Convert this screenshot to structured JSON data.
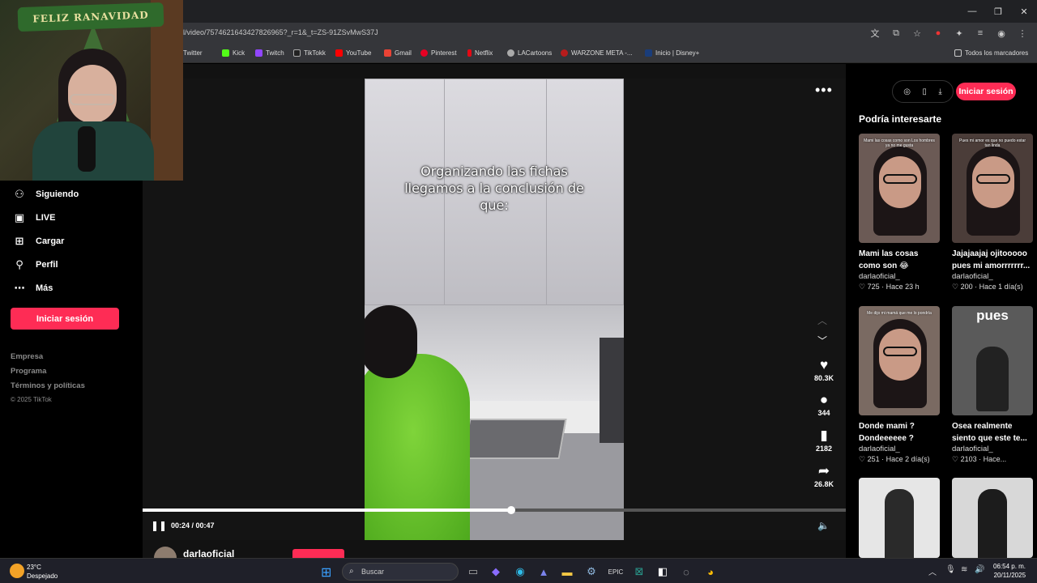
{
  "browser": {
    "url": "l/video/7574621643427826965?_r=1&_t=ZS-91ZSvMwS37J",
    "bookmarks": [
      "Twitter",
      "Kick",
      "Twitch",
      "TikTokk",
      "YouTube",
      "Gmail",
      "Pinterest",
      "Netflix",
      "LACartoons",
      "WARZONE META -...",
      "Inicio | Disney+"
    ],
    "all_bookmarks": "Todos los marcadores"
  },
  "sidebar": {
    "items": [
      {
        "label": "Siguiendo",
        "icon": "following-icon"
      },
      {
        "label": "LIVE",
        "icon": "live-icon"
      },
      {
        "label": "Cargar",
        "icon": "upload-icon"
      },
      {
        "label": "Perfil",
        "icon": "profile-icon"
      },
      {
        "label": "Más",
        "icon": "more-icon"
      }
    ],
    "login_label": "Iniciar sesión",
    "footer_links": [
      "Empresa",
      "Programa",
      "Términos y políticas"
    ],
    "copyright": "© 2025 TikTok"
  },
  "webcam": {
    "banner": "FELIZ RANAVIDAD"
  },
  "video": {
    "caption": "Organizando las fichas llegamos a la conclusión de que:",
    "time_current": "00:24",
    "time_total": "00:47",
    "progress": 0.524,
    "likes": "80.3K",
    "comments": "344",
    "saves": "2182",
    "shares": "26.8K",
    "author": "darlaoficial"
  },
  "right_panel": {
    "login_label": "Iniciar sesión",
    "section_title": "Podría interesarte",
    "cards": [
      {
        "title": "Mami las cosas como son 😂",
        "author": "darlaoficial_",
        "likes": "725",
        "ago": "Hace 23 h",
        "thumb_text": "Mami las cosas como son Los hombres ya no me gusta",
        "accent": "#6b5a55"
      },
      {
        "title": "Jajajaajaj ojitooooo pues mi amorrrrrrr...",
        "author": "darlaoficial_",
        "likes": "200",
        "ago": "Hace 1 día(s)",
        "thumb_text": "Pues mi amor es que no puedo estar tan linda",
        "accent": "#4b3d39"
      },
      {
        "title": "Donde mami ? Dondeeeeee ?",
        "author": "darlaoficial_",
        "likes": "251",
        "ago": "Hace 2 día(s)",
        "thumb_text": "Me dijo mi mamá que me lo pondría",
        "accent": "#7a6a62"
      },
      {
        "title": "Osea realmente siento que este te...",
        "author": "darlaoficial_",
        "likes": "2103",
        "ago": "Hace...",
        "thumb_text": "pues",
        "accent": "#5a5a5a"
      }
    ]
  },
  "taskbar": {
    "temp": "23°C",
    "weather": "Despejado",
    "search_placeholder": "Buscar",
    "time": "06:54 p. m.",
    "date": "20/11/2025"
  },
  "colors": {
    "accent": "#fe2c55",
    "panel": "#000000",
    "video_bg": "#141414"
  }
}
